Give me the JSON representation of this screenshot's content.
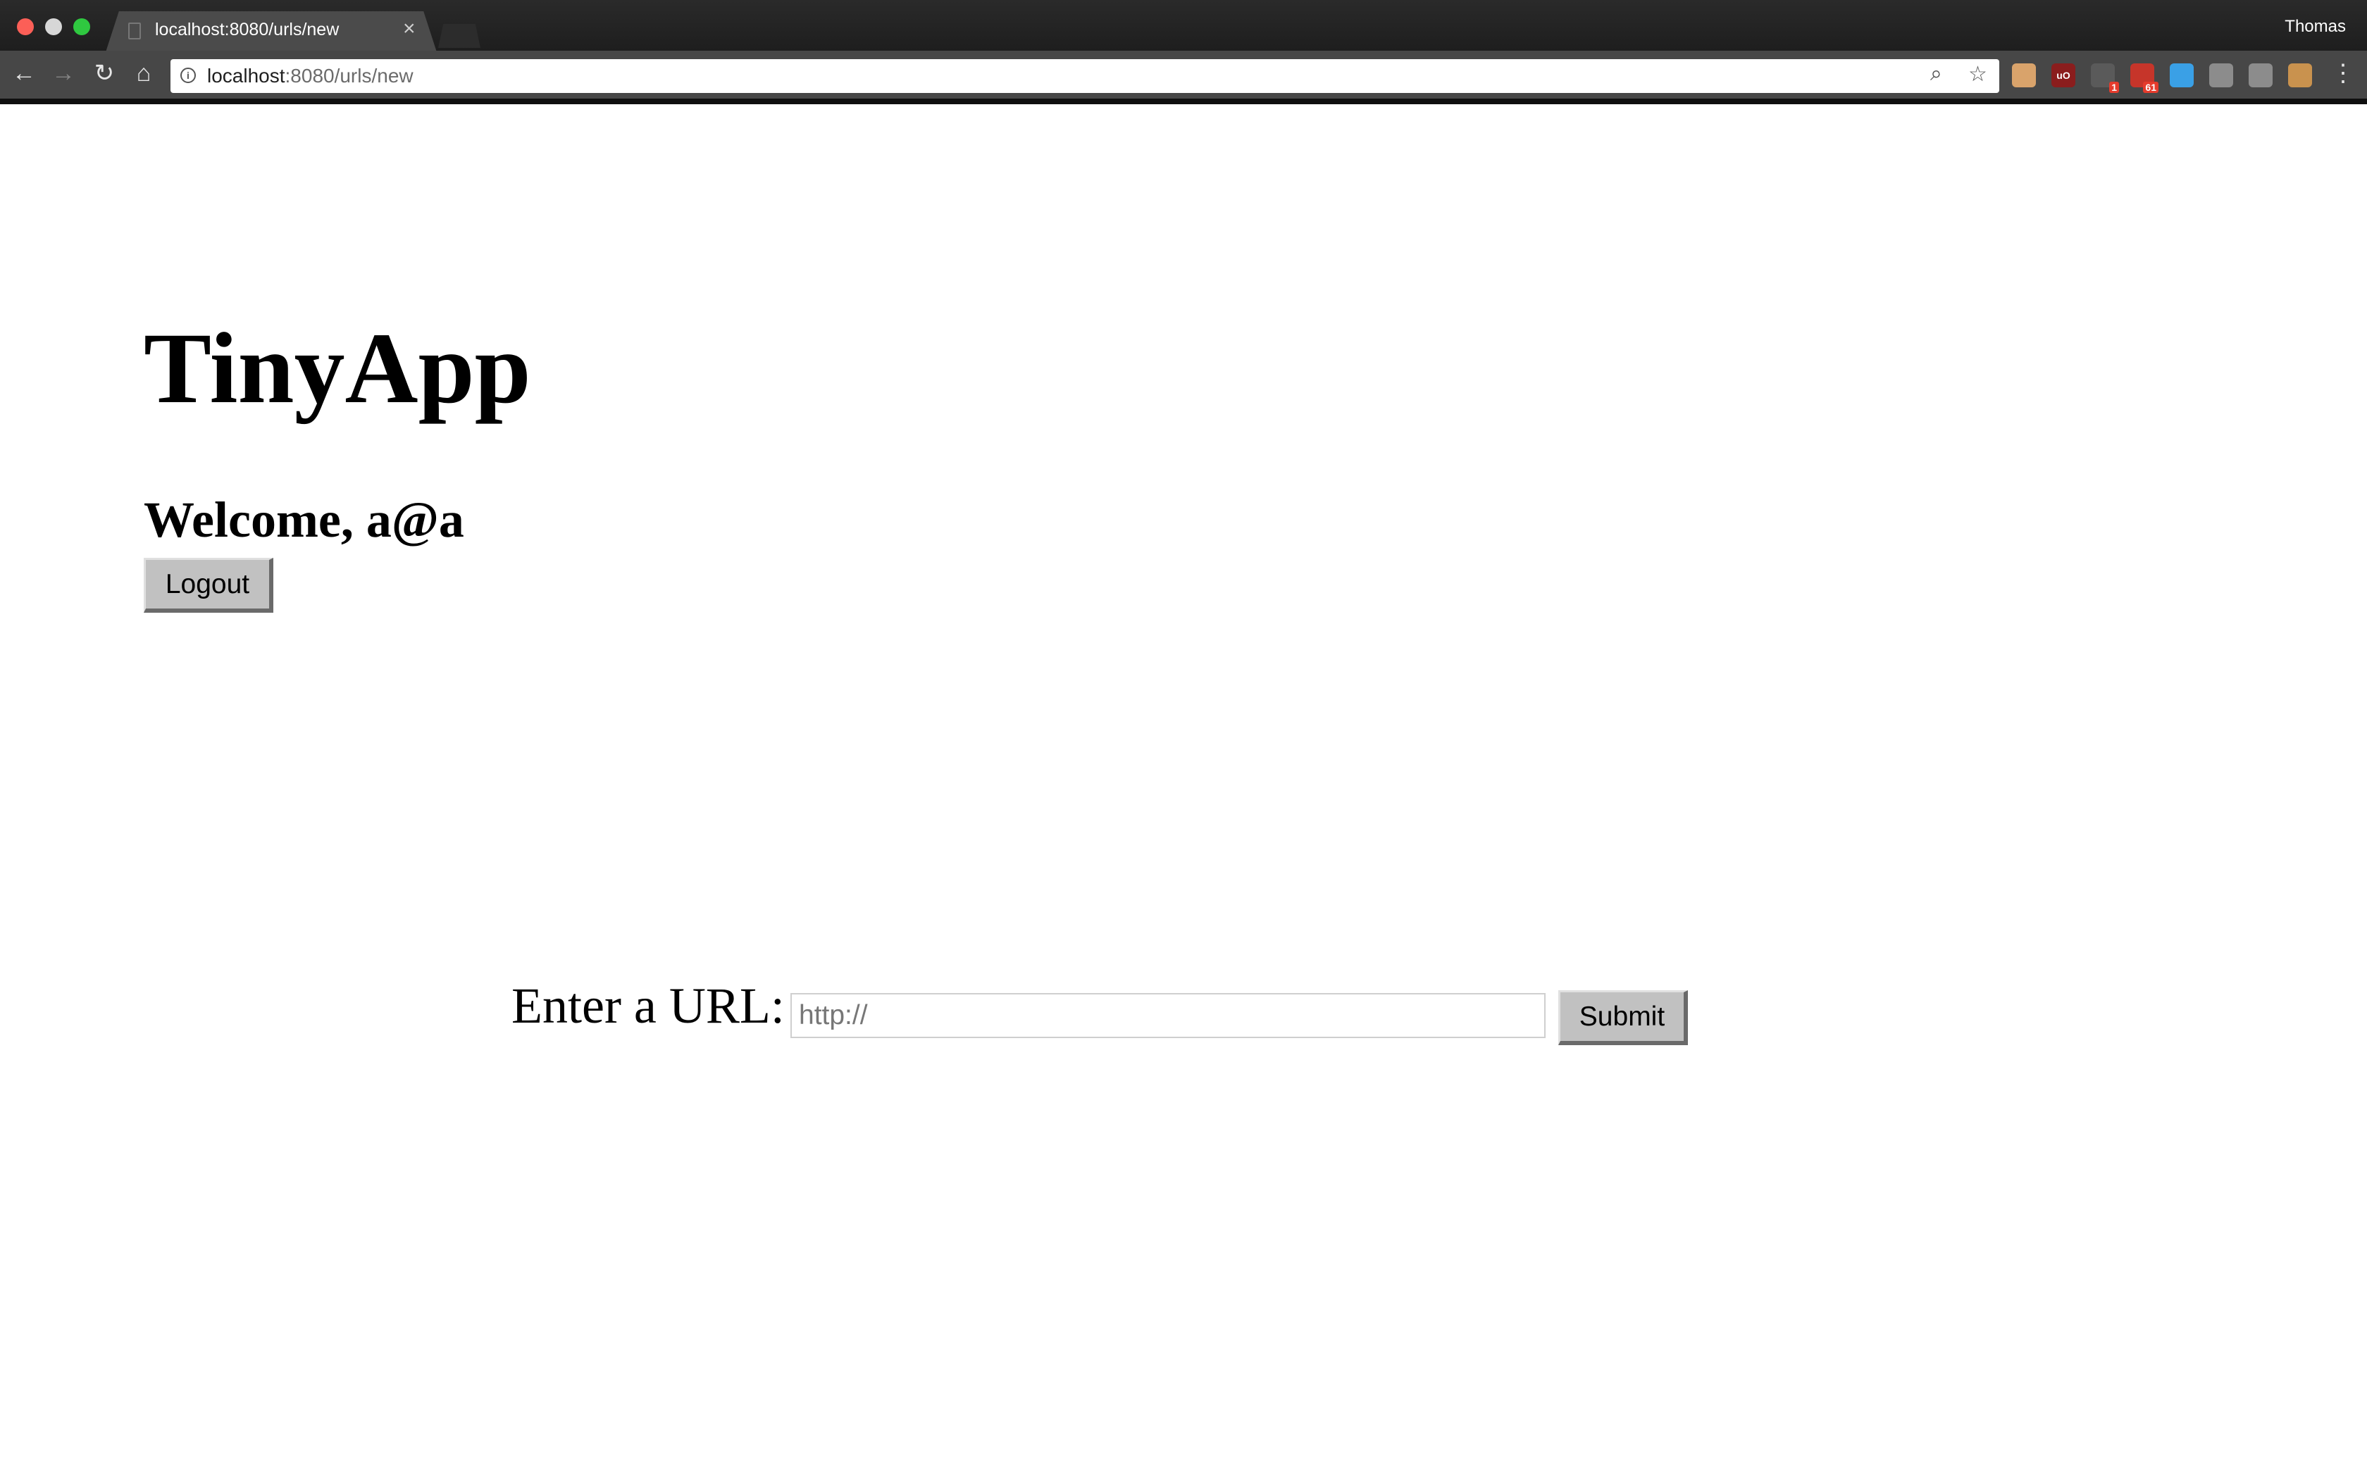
{
  "browser": {
    "tab_title": "localhost:8080/urls/new",
    "tab_close": "×",
    "profile_name": "Thomas",
    "url_host": "localhost",
    "url_rest": ":8080/urls/new",
    "extensions": [
      {
        "icon": "honey-extension-icon",
        "color": "#d9a36b",
        "label": "",
        "badge": ""
      },
      {
        "icon": "ublock-origin-icon",
        "color": "#8a1d1d",
        "label": "uO",
        "badge": ""
      },
      {
        "icon": "counter-extension-icon",
        "color": "#5a5a5a",
        "label": "",
        "badge": "1"
      },
      {
        "icon": "mail-extension-icon",
        "color": "#c6352a",
        "label": "",
        "badge": "61"
      },
      {
        "icon": "diamond-extension-icon",
        "color": "#3aa0e6",
        "label": "",
        "badge": ""
      },
      {
        "icon": "pocket-extension-icon",
        "color": "#8c8c8c",
        "label": "",
        "badge": ""
      },
      {
        "icon": "checklist-extension-icon",
        "color": "#8c8c8c",
        "label": "",
        "badge": ""
      },
      {
        "icon": "cookie-extension-icon",
        "color": "#c9924e",
        "label": "",
        "badge": ""
      }
    ]
  },
  "page": {
    "title": "TinyApp",
    "welcome": "Welcome, a@a",
    "logout_label": "Logout",
    "url_label": "Enter a URL:",
    "url_placeholder": "http://",
    "url_value": "",
    "submit_label": "Submit"
  }
}
